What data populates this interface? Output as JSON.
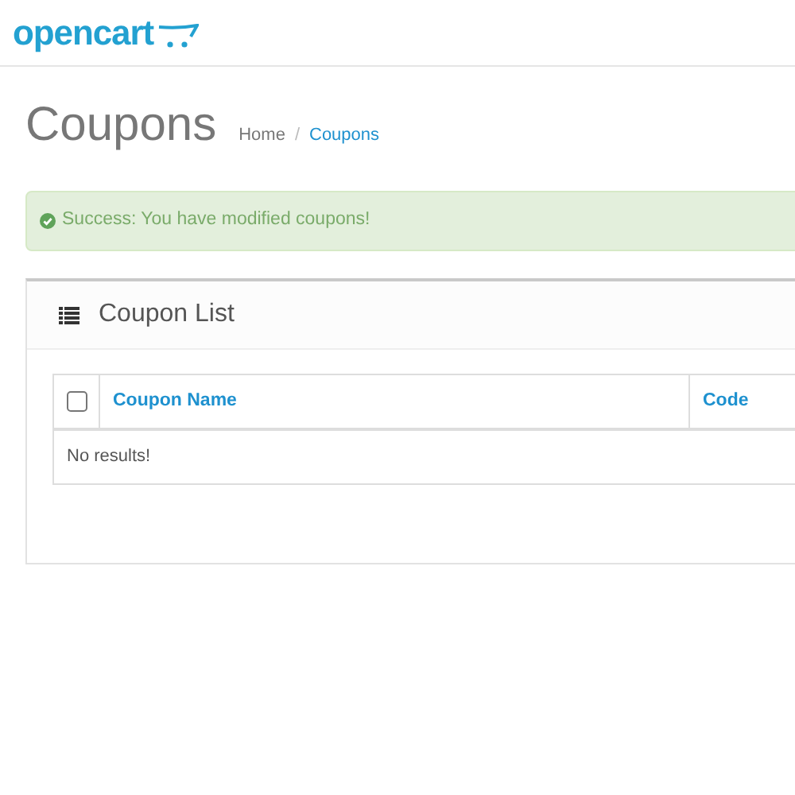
{
  "header": {
    "logo": "opencart"
  },
  "page": {
    "title": "Coupons",
    "breadcrumb_separator": "/",
    "breadcrumb": [
      {
        "label": "Home",
        "selected": false
      },
      {
        "label": "Coupons",
        "selected": true
      }
    ]
  },
  "alert": {
    "text": "Success: You have modified coupons!"
  },
  "panel": {
    "title": "Coupon List",
    "table": {
      "select_all": {
        "checked": false
      },
      "columns": [
        "Coupon Name",
        "Code"
      ],
      "empty_message": "No results!"
    }
  }
}
